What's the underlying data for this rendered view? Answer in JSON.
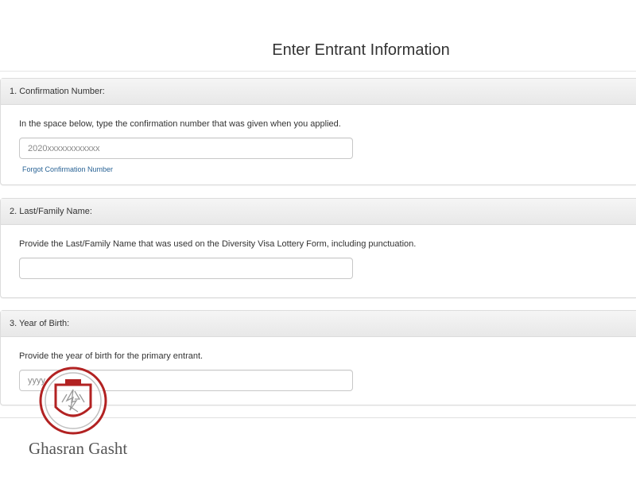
{
  "page": {
    "title": "Enter Entrant Information"
  },
  "sections": [
    {
      "heading": "1. Confirmation Number:",
      "instruction": "In the space below, type the confirmation number that was given when you applied.",
      "input_placeholder": "2020xxxxxxxxxxxx",
      "input_value": "",
      "link": "Forgot Confirmation Number"
    },
    {
      "heading": "2. Last/Family Name:",
      "instruction": "Provide the Last/Family Name that was used on the Diversity Visa Lottery Form, including punctuation.",
      "input_placeholder": "",
      "input_value": ""
    },
    {
      "heading": "3. Year of Birth:",
      "instruction": "Provide the year of birth for the primary entrant.",
      "input_placeholder": "yyyy",
      "input_value": ""
    }
  ],
  "watermark": {
    "text": "Ghasran Gasht",
    "colors": {
      "ring": "#b22222",
      "text": "#555555"
    }
  }
}
